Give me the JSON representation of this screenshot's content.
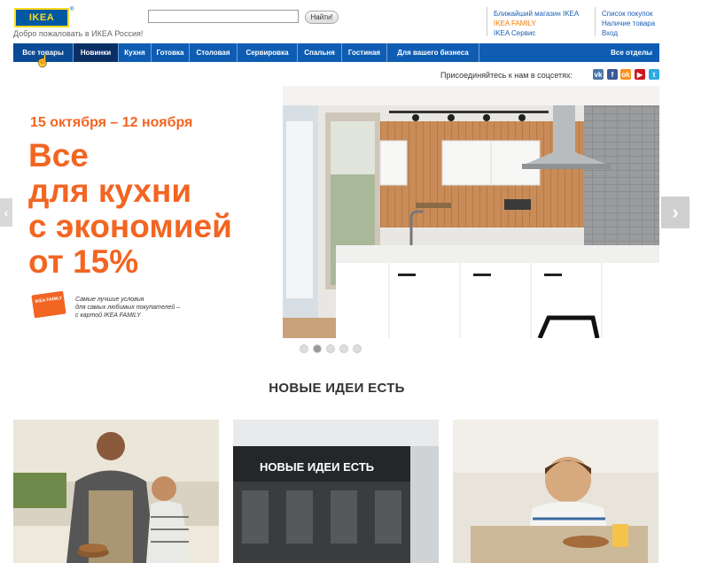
{
  "header": {
    "logo_text": "IKEA",
    "welcome": "Добро пожаловать в ИКЕА Россия!",
    "search_button": "Найти!",
    "search_value": "",
    "links_col1": [
      "Ближайший магазин IKEA",
      "IKEA FAMILY",
      "IKEA Сервис"
    ],
    "links_col2": [
      "Список покупок",
      "Наличие товара",
      "Вход"
    ]
  },
  "nav": {
    "items": [
      "Все товары",
      "Новинки",
      "Кухня",
      "Готовка",
      "Столовая",
      "Сервировка",
      "Спальня",
      "Гостиная",
      "Для вашего бизнеса",
      "Все отделы"
    ]
  },
  "social": {
    "label": "Присоединяйтесь к нам в соцсетях:",
    "icons": [
      "vk-icon",
      "facebook-icon",
      "odnoklassniki-icon",
      "youtube-icon",
      "twitter-icon"
    ]
  },
  "hero": {
    "date": "15 октября – 12 ноября",
    "headline": [
      "Все",
      "для кухни",
      "с экономией",
      "от 15%"
    ],
    "card_label": "IKEA FAMILY",
    "family_text": [
      "Самые лучшие условия",
      "для самых любимых покупателей –",
      "с картой IKEA FAMILY"
    ],
    "slides_count": 5,
    "active_slide": 2
  },
  "section": {
    "title": "НОВЫЕ ИДЕИ ЕСТЬ",
    "cafe_sign": "НОВЫЕ ИДЕИ ЕСТЬ"
  },
  "colors": {
    "brand_blue": "#0058a3",
    "brand_yellow": "#ffda1a",
    "accent_orange": "#f26522"
  }
}
